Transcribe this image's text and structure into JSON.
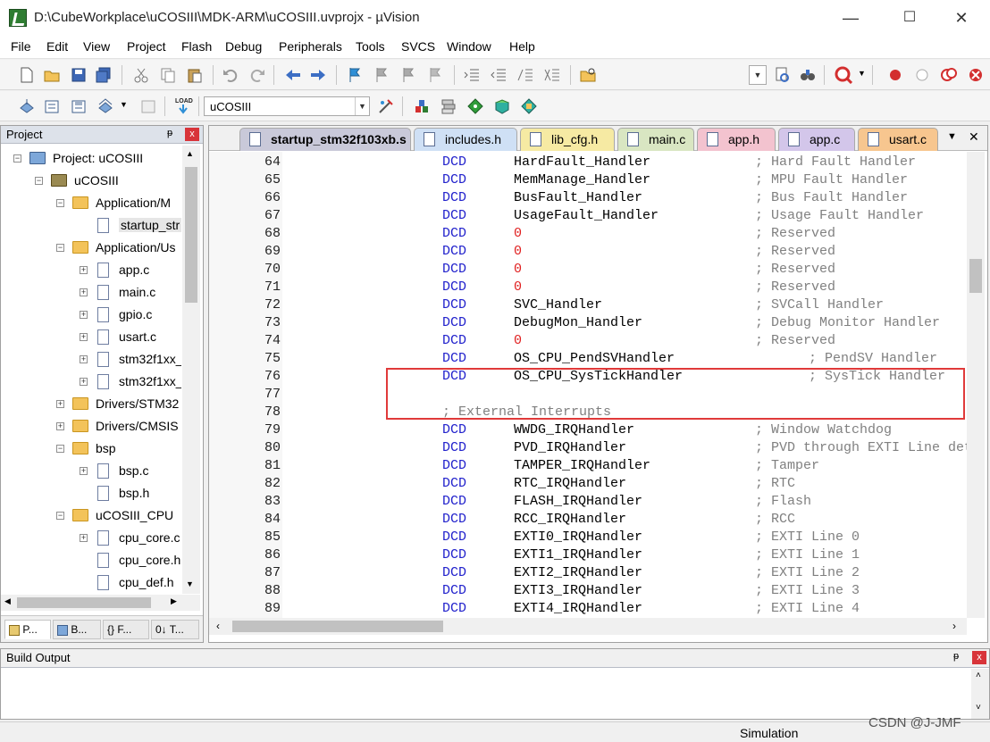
{
  "window": {
    "title": "D:\\CubeWorkplace\\uCOSIII\\MDK-ARM\\uCOSIII.uvprojx - µVision",
    "minimize": "—",
    "maximize": "☐",
    "close": "✕"
  },
  "menu": [
    "File",
    "Edit",
    "View",
    "Project",
    "Flash",
    "Debug",
    "Peripherals",
    "Tools",
    "SVCS",
    "Window",
    "Help"
  ],
  "toolbar2": {
    "target": "uCOSIII",
    "load_label": "LOAD"
  },
  "project_panel": {
    "title": "Project",
    "pin": "ᵽ",
    "close": "x",
    "tree": [
      {
        "label": "Project: uCOSIII",
        "icon": "project-icon",
        "exp": "−"
      },
      {
        "label": "uCOSIII",
        "icon": "target-icon",
        "exp": "−"
      },
      {
        "label": "Application/M",
        "icon": "folder-icon",
        "exp": "−"
      },
      {
        "label": "startup_str",
        "icon": "file-icon",
        "exp": ""
      },
      {
        "label": "Application/Us",
        "icon": "folder-icon",
        "exp": "−"
      },
      {
        "label": "app.c",
        "icon": "file-icon",
        "exp": "+"
      },
      {
        "label": "main.c",
        "icon": "file-icon",
        "exp": "+"
      },
      {
        "label": "gpio.c",
        "icon": "file-icon",
        "exp": "+"
      },
      {
        "label": "usart.c",
        "icon": "file-icon",
        "exp": "+"
      },
      {
        "label": "stm32f1xx_",
        "icon": "file-icon",
        "exp": "+"
      },
      {
        "label": "stm32f1xx_",
        "icon": "file-icon",
        "exp": "+"
      },
      {
        "label": "Drivers/STM32",
        "icon": "folder-icon",
        "exp": "+"
      },
      {
        "label": "Drivers/CMSIS",
        "icon": "folder-icon",
        "exp": "+"
      },
      {
        "label": "bsp",
        "icon": "folder-icon",
        "exp": "−"
      },
      {
        "label": "bsp.c",
        "icon": "file-icon",
        "exp": "+"
      },
      {
        "label": "bsp.h",
        "icon": "file-icon",
        "exp": ""
      },
      {
        "label": "uCOSIII_CPU",
        "icon": "folder-icon",
        "exp": "−"
      },
      {
        "label": "cpu_core.c",
        "icon": "file-icon",
        "exp": "+"
      },
      {
        "label": "cpu_core.h",
        "icon": "file-icon",
        "exp": ""
      },
      {
        "label": "cpu_def.h",
        "icon": "file-icon",
        "exp": ""
      }
    ],
    "bottom_tabs": [
      "P...",
      "B...",
      "{} F...",
      "0↓ T..."
    ]
  },
  "editor": {
    "tabs": [
      {
        "label": "startup_stm32f103xb.s",
        "color": "#c8c8d8",
        "active": true
      },
      {
        "label": "includes.h",
        "color": "#cfe0f5"
      },
      {
        "label": "lib_cfg.h",
        "color": "#f6eaa3"
      },
      {
        "label": "main.c",
        "color": "#d9e6c2"
      },
      {
        "label": "app.h",
        "color": "#f3c3cf"
      },
      {
        "label": "app.c",
        "color": "#d3c6ea"
      },
      {
        "label": "usart.c",
        "color": "#f7c68f"
      }
    ],
    "tab_overflow": "▼",
    "tab_close": "✕",
    "lines": [
      {
        "n": "64",
        "kw": "DCD",
        "arg": "HardFault_Handler",
        "cm": "; Hard Fault Handler"
      },
      {
        "n": "65",
        "kw": "DCD",
        "arg": "MemManage_Handler",
        "cm": "; MPU Fault Handler"
      },
      {
        "n": "66",
        "kw": "DCD",
        "arg": "BusFault_Handler",
        "cm": "; Bus Fault Handler"
      },
      {
        "n": "67",
        "kw": "DCD",
        "arg": "UsageFault_Handler",
        "cm": "; Usage Fault Handler"
      },
      {
        "n": "68",
        "kw": "DCD",
        "arg": "0",
        "cm": "; Reserved",
        "zero": true
      },
      {
        "n": "69",
        "kw": "DCD",
        "arg": "0",
        "cm": "; Reserved",
        "zero": true
      },
      {
        "n": "70",
        "kw": "DCD",
        "arg": "0",
        "cm": "; Reserved",
        "zero": true
      },
      {
        "n": "71",
        "kw": "DCD",
        "arg": "0",
        "cm": "; Reserved",
        "zero": true
      },
      {
        "n": "72",
        "kw": "DCD",
        "arg": "SVC_Handler",
        "cm": "; SVCall Handler"
      },
      {
        "n": "73",
        "kw": "DCD",
        "arg": "DebugMon_Handler",
        "cm": "; Debug Monitor Handler"
      },
      {
        "n": "74",
        "kw": "DCD",
        "arg": "0",
        "cm": "; Reserved",
        "zero": true
      },
      {
        "n": "75",
        "kw": "DCD",
        "arg": "OS_CPU_PendSVHandler",
        "cm": "; PendSV Handler",
        "shift": true
      },
      {
        "n": "76",
        "kw": "DCD",
        "arg": "OS_CPU_SysTickHandler",
        "cm": "; SysTick Handler",
        "shift": true
      },
      {
        "n": "77",
        "kw": "",
        "arg": "",
        "cm": ""
      },
      {
        "n": "78",
        "kw": "",
        "arg": "",
        "cm": "; External Interrupts",
        "section": true
      },
      {
        "n": "79",
        "kw": "DCD",
        "arg": "WWDG_IRQHandler",
        "cm": "; Window Watchdog"
      },
      {
        "n": "80",
        "kw": "DCD",
        "arg": "PVD_IRQHandler",
        "cm": "; PVD through EXTI Line detect"
      },
      {
        "n": "81",
        "kw": "DCD",
        "arg": "TAMPER_IRQHandler",
        "cm": "; Tamper"
      },
      {
        "n": "82",
        "kw": "DCD",
        "arg": "RTC_IRQHandler",
        "cm": "; RTC"
      },
      {
        "n": "83",
        "kw": "DCD",
        "arg": "FLASH_IRQHandler",
        "cm": "; Flash"
      },
      {
        "n": "84",
        "kw": "DCD",
        "arg": "RCC_IRQHandler",
        "cm": "; RCC"
      },
      {
        "n": "85",
        "kw": "DCD",
        "arg": "EXTI0_IRQHandler",
        "cm": "; EXTI Line 0"
      },
      {
        "n": "86",
        "kw": "DCD",
        "arg": "EXTI1_IRQHandler",
        "cm": "; EXTI Line 1"
      },
      {
        "n": "87",
        "kw": "DCD",
        "arg": "EXTI2_IRQHandler",
        "cm": "; EXTI Line 2"
      },
      {
        "n": "88",
        "kw": "DCD",
        "arg": "EXTI3_IRQHandler",
        "cm": "; EXTI Line 3"
      },
      {
        "n": "89",
        "kw": "DCD",
        "arg": "EXTI4_IRQHandler",
        "cm": "; EXTI Line 4"
      }
    ]
  },
  "build_output": {
    "title": "Build Output",
    "pin": "ᵽ",
    "close": "x"
  },
  "status": {
    "mode": "Simulation",
    "watermark": "CSDN @J-JMF"
  },
  "colors": {
    "keyword": "#2222cc",
    "zero": "#e02020",
    "comment": "#808080",
    "highlight_box": "#e03a3a"
  }
}
